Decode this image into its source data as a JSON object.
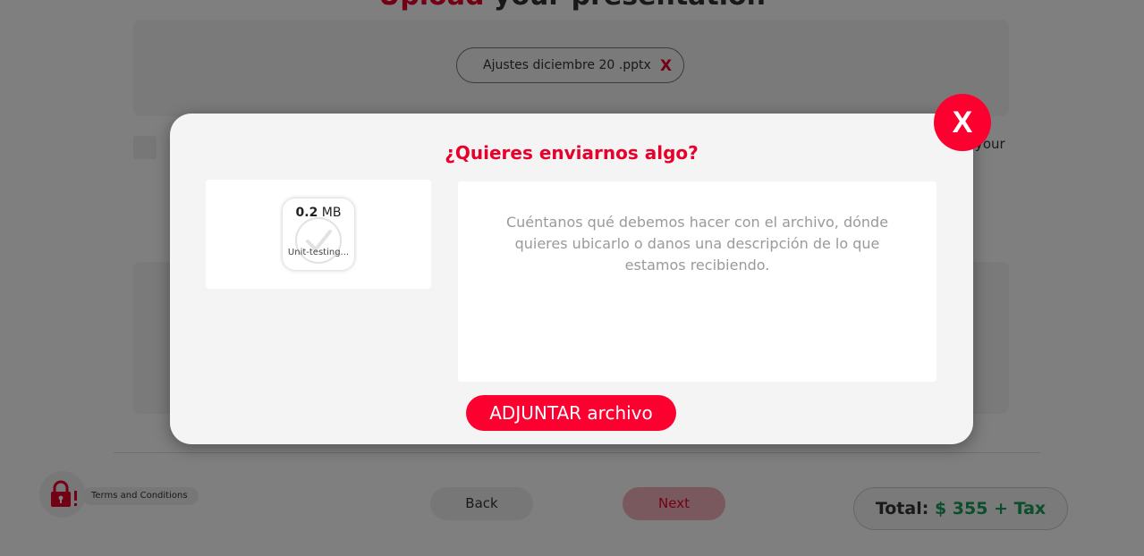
{
  "background": {
    "heading_part1": "Upload",
    "heading_part2": " your presentation",
    "file_chip": {
      "name": "Ajustes diciembre 20 .pptx",
      "remove_label": "X"
    },
    "side_text": "your",
    "terms_label": "Terms and Conditions",
    "back_label": "Back",
    "next_label": "Next",
    "total": {
      "label": "Total:",
      "amount": "$ 355 + Tax"
    }
  },
  "modal": {
    "title": "¿Quieres enviarnos algo?",
    "close_label": "X",
    "attachment": {
      "size_value": "0.2",
      "size_unit": " MB",
      "file_name": "Unit-testing..."
    },
    "message_placeholder": "Cuéntanos qué debemos hacer con el archivo, dónde quieres ubicarlo o danos una descripción de lo que estamos recibiendo.",
    "attach_button_label": "ADJUNTAR archivo"
  },
  "colors": {
    "accent_red": "#fc0030",
    "heading_red": "#e8002a",
    "total_green": "#169c57"
  }
}
